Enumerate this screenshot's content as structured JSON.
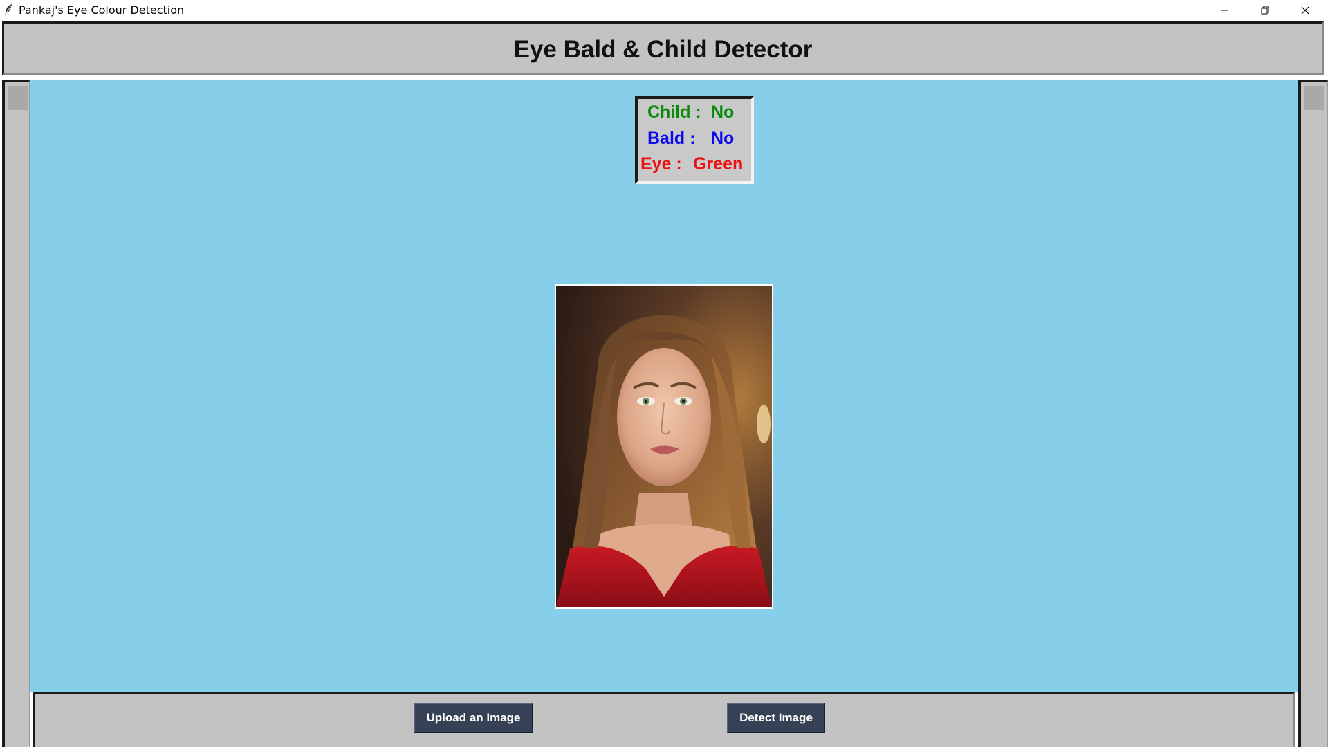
{
  "window": {
    "title": "Pankaj's Eye Colour Detection",
    "controls": [
      "minimize-icon",
      "restore-icon",
      "close-icon"
    ]
  },
  "header": {
    "title": "Eye Bald & Child Detector"
  },
  "results": {
    "child": {
      "label": "Child :",
      "value": "No",
      "color": "#0a8a0a"
    },
    "bald": {
      "label": "Bald  :",
      "value": "No",
      "color": "#0a0aee"
    },
    "eye": {
      "label": "Eye :",
      "value": "Green",
      "color": "#ee1111"
    }
  },
  "buttons": {
    "upload": "Upload an Image",
    "detect": "Detect Image"
  },
  "colors": {
    "canvas_background": "#87ceeb",
    "frame_gray": "#c3c3c3",
    "button_background": "#364156"
  }
}
